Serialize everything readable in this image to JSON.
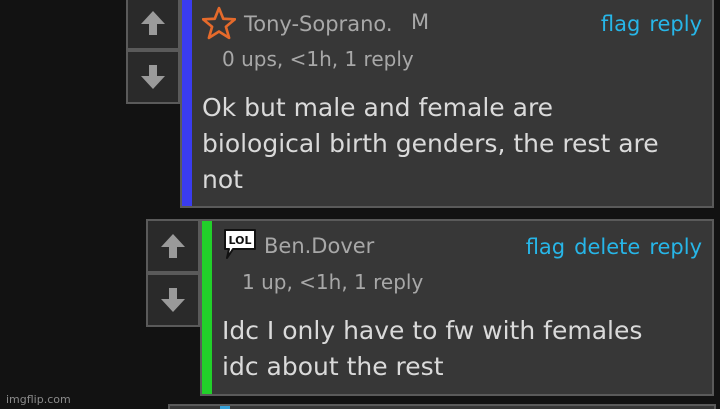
{
  "comments": [
    {
      "username": "Tony-Soprano.",
      "badge": "M",
      "meta": "0 ups, <1h, 1 reply",
      "actions": [
        "flag",
        "reply"
      ],
      "text_lines": [
        "Ok but male and female are",
        "biological birth genders, the rest are",
        "not"
      ],
      "accent_color": "#3a3cf0",
      "user_icon": "star-icon"
    },
    {
      "username": "Ben.Dover",
      "meta": "1 up, <1h, 1 reply",
      "actions": [
        "flag",
        "delete",
        "reply"
      ],
      "text_lines": [
        "Idc I only have to fw with females",
        "idc about the rest"
      ],
      "accent_color": "#22d02a",
      "user_icon": "lol-speech-bubble-icon",
      "user_icon_text": "LOL"
    }
  ],
  "watermark": "imgflip.com",
  "colors": {
    "background": "#121212",
    "card": "#373737",
    "link": "#27b6e8",
    "muted_text": "#a8a8a8",
    "body_text": "#dadada"
  }
}
